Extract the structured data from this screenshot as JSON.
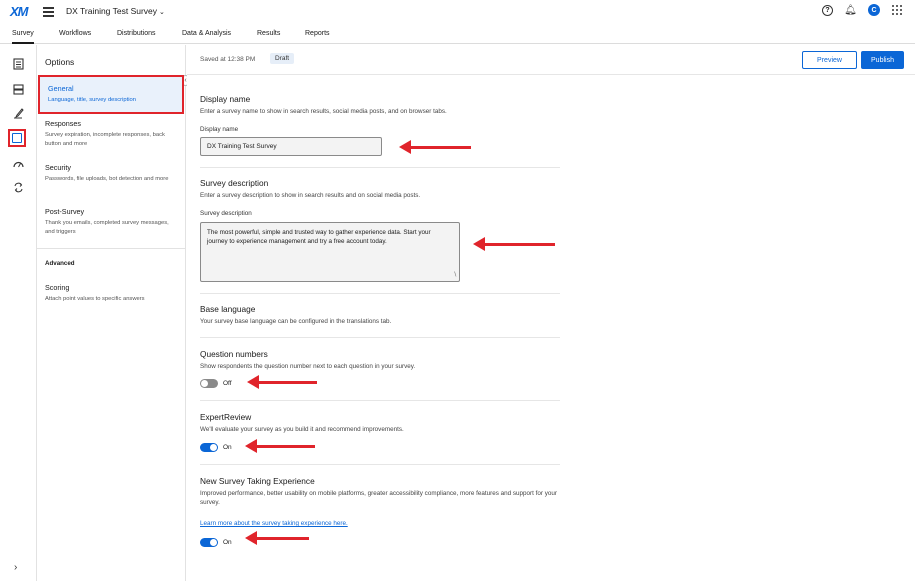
{
  "app": {
    "logo": "XM",
    "survey_title": "DX Training Test Survey",
    "avatar_initial": "C",
    "help_glyph": "?"
  },
  "tabs": [
    {
      "label": "Survey",
      "active": true
    },
    {
      "label": "Workflows"
    },
    {
      "label": "Distributions"
    },
    {
      "label": "Data & Analysis"
    },
    {
      "label": "Results"
    },
    {
      "label": "Reports"
    }
  ],
  "rail": {
    "icons": [
      "survey-flow-icon",
      "blocks-icon",
      "paint-brush-icon",
      "survey-options-icon",
      "gauge-icon",
      "translate-icon"
    ],
    "active_icon": "survey-options-icon"
  },
  "options": {
    "title": "Options",
    "items": [
      {
        "name": "General",
        "desc": "Language, title, survey description",
        "active": true
      },
      {
        "name": "Responses",
        "desc": "Survey expiration, incomplete responses, back button and more"
      },
      {
        "name": "Security",
        "desc": "Passwords, file uploads, bot detection and more"
      },
      {
        "name": "Post-Survey",
        "desc": "Thank you emails, completed survey messages, and triggers"
      }
    ],
    "advanced_label": "Advanced",
    "advanced_items": [
      {
        "name": "Scoring",
        "desc": "Attach point values to specific answers"
      }
    ]
  },
  "status": {
    "saved_text": "Saved at 12:38 PM",
    "draft_badge": "Draft",
    "preview_label": "Preview",
    "publish_label": "Publish"
  },
  "general": {
    "display_name": {
      "title": "Display name",
      "desc": "Enter a survey name to show in search results, social media posts, and on browser tabs.",
      "label": "Display name",
      "value": "DX Training Test Survey"
    },
    "survey_description": {
      "title": "Survey description",
      "desc": "Enter a survey description to show in search results and on social media posts.",
      "label": "Survey description",
      "value": "The most powerful, simple and trusted way to gather experience data. Start your journey to experience management and try a free account today."
    },
    "base_language": {
      "title": "Base language",
      "desc": "Your survey base language can be configured in the translations tab."
    },
    "question_numbers": {
      "title": "Question numbers",
      "desc": "Show respondents the question number next to each question in your survey.",
      "state": "Off"
    },
    "expert_review": {
      "title": "ExpertReview",
      "desc": "We'll evaluate your survey as you build it and recommend improvements.",
      "state": "On"
    },
    "new_experience": {
      "title": "New Survey Taking Experience",
      "desc": "Improved performance, better usability on mobile platforms, greater accessibility compliance, more features and support for your survey.",
      "link": "Learn more about the survey taking experience here.",
      "state": "On"
    }
  },
  "colors": {
    "accent": "#0b66d6",
    "annotation_red": "#e0242b"
  }
}
